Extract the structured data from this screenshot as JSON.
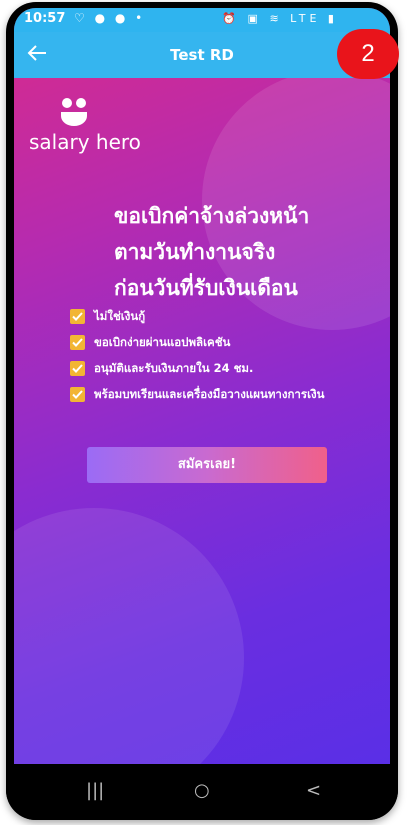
{
  "status_bar": {
    "time": "10:57",
    "left_icons": "♡ ● ● •",
    "right_icons": "⏰ ▣ ≋ LTE ▮"
  },
  "app_bar": {
    "title": "Test RD",
    "back_icon": "arrow-left-icon"
  },
  "logo": {
    "text": "salary hero"
  },
  "headline": {
    "line1": "ขอเบิกค่าจ้างล่วงหน้า",
    "line2": "ตามวันทำงานจริง",
    "line3": "ก่อนวันที่รับเงินเดือน"
  },
  "features": [
    {
      "label": "ไม่ใช่เงินกู้"
    },
    {
      "label": "ขอเบิกง่ายผ่านแอปพลิเคชัน"
    },
    {
      "label": "อนุมัติและรับเงินภายใน 24 ชม."
    },
    {
      "label": "พร้อมบทเรียนและเครื่องมือวางแผนทางการเงิน"
    }
  ],
  "cta": {
    "label": "สมัครเลย!"
  },
  "nav_bar": {
    "recent": "|||",
    "home": "○",
    "back": "<"
  },
  "badge": {
    "label": "2"
  },
  "colors": {
    "appbar": "#35b5ef",
    "accent_check": "#f2b534",
    "badge": "#e9141b"
  }
}
